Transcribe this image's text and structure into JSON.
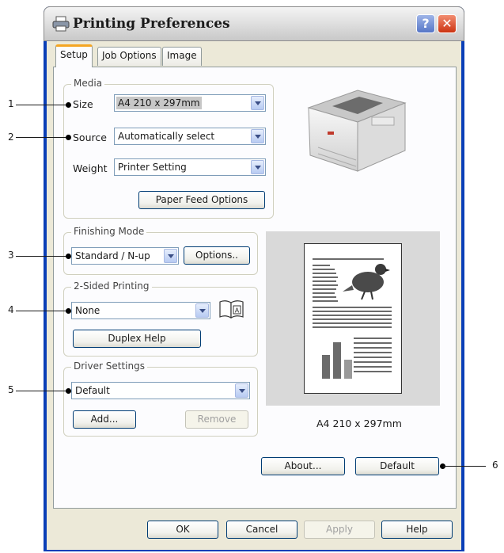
{
  "window": {
    "title": "Printing Preferences",
    "help_glyph": "?",
    "close_glyph": "✕"
  },
  "tabs": [
    {
      "label": "Setup"
    },
    {
      "label": "Job Options"
    },
    {
      "label": "Image"
    }
  ],
  "media": {
    "legend": "Media",
    "size_label": "Size",
    "size_value": "A4 210 x 297mm",
    "source_label": "Source",
    "source_value": "Automatically select",
    "weight_label": "Weight",
    "weight_value": "Printer Setting",
    "paper_feed_button": "Paper Feed Options"
  },
  "finishing": {
    "legend": "Finishing Mode",
    "mode_value": "Standard / N-up",
    "options_button": "Options.."
  },
  "duplex": {
    "legend": "2-Sided Printing",
    "value": "None",
    "help_button": "Duplex Help"
  },
  "driver": {
    "legend": "Driver Settings",
    "value": "Default",
    "add_button": "Add...",
    "remove_button": "Remove"
  },
  "preview": {
    "caption": "A4 210 x 297mm"
  },
  "panel_buttons": {
    "about": "About...",
    "default": "Default"
  },
  "dialog_buttons": {
    "ok": "OK",
    "cancel": "Cancel",
    "apply": "Apply",
    "help": "Help"
  },
  "callouts": [
    "1",
    "2",
    "3",
    "4",
    "5",
    "6"
  ],
  "colors": {
    "accent_tab": "#f5a623",
    "title_bar": "#dcdcdc",
    "dialog_bg": "#ece9d8",
    "close": "#cc3312"
  }
}
